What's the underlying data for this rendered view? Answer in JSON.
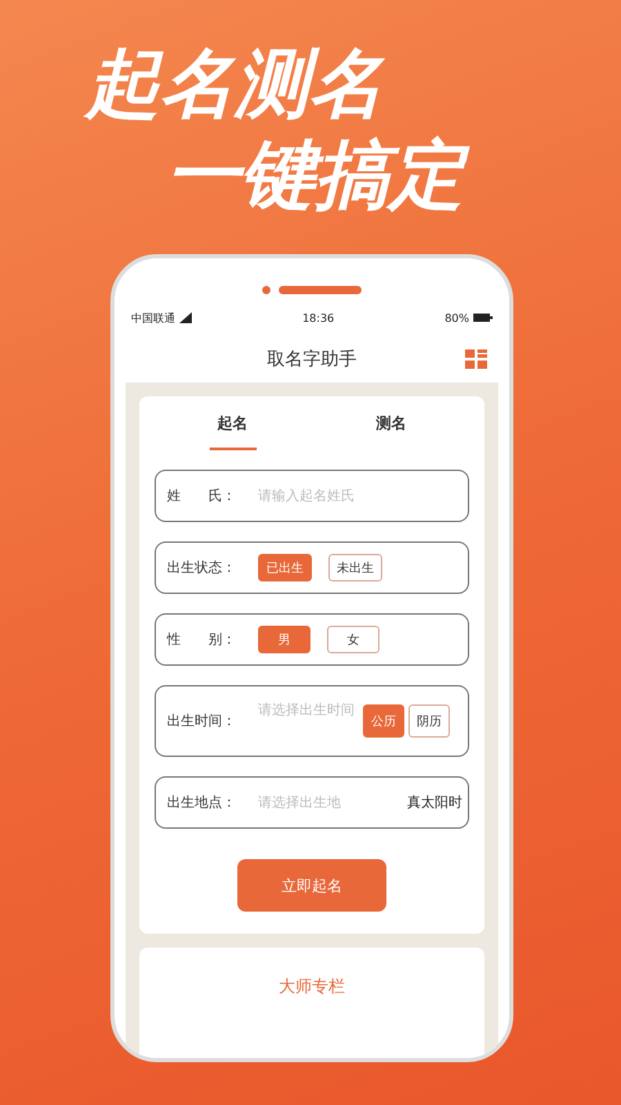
{
  "headline": [
    "起名测名",
    "一键搞定"
  ],
  "status_bar": {
    "carrier": "中国联通",
    "time": "18:36",
    "battery": "80%"
  },
  "app_title": "取名字助手",
  "tabs": [
    {
      "label": "起名",
      "selected": true
    },
    {
      "label": "测名",
      "selected": false
    }
  ],
  "form_rows": [
    {
      "kind": "input",
      "label": "姓　　氏：",
      "placeholder": "请输入起名姓氏"
    },
    {
      "kind": "choice",
      "label": "出生状态：",
      "options": [
        {
          "label": "已出生",
          "selected": true
        },
        {
          "label": "未出生",
          "selected": false
        }
      ]
    },
    {
      "kind": "choice",
      "label": "性　　别：",
      "options": [
        {
          "label": "男",
          "selected": true
        },
        {
          "label": "女",
          "selected": false
        }
      ]
    },
    {
      "kind": "time",
      "label": "出生时间：",
      "placeholder": "请选择出生时间",
      "options": [
        {
          "label": "公历",
          "selected": true
        },
        {
          "label": "阴历",
          "selected": false
        }
      ]
    },
    {
      "kind": "place",
      "label": "出生地点：",
      "placeholder": "请选择出生地",
      "extra": "真太阳时"
    }
  ],
  "submit_button": "立即起名",
  "section_title": "大师专栏"
}
